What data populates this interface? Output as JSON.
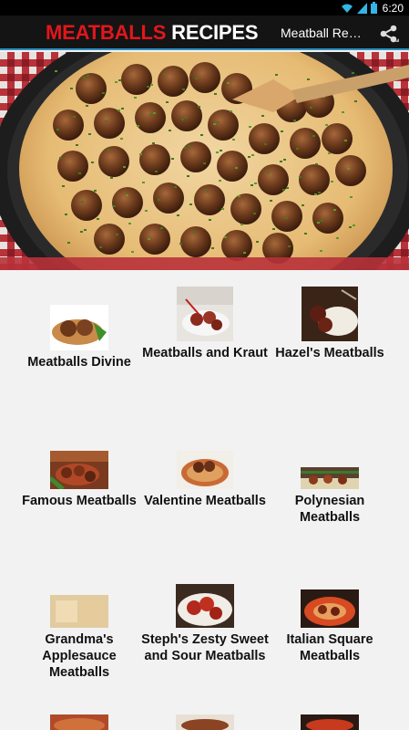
{
  "status_bar": {
    "time": "6:20",
    "icons": [
      "wifi-icon",
      "signal-icon",
      "battery-icon"
    ]
  },
  "header": {
    "title_part1": "MEATBALLS",
    "title_part2": "RECIPES",
    "subtitle": "Meatball Recipes",
    "share_icon": "share-icon",
    "colors": {
      "title_red": "#e3161b",
      "bar": "#141414",
      "accent": "#2d8fbe"
    }
  },
  "hero": {
    "alt": "Meatballs in creamy sauce with parsley in a skillet"
  },
  "recipes": [
    {
      "label": "Meatballs Divine"
    },
    {
      "label": "Meatballs and Kraut"
    },
    {
      "label": "Hazel's Meatballs"
    },
    {
      "label": "Famous Meatballs"
    },
    {
      "label": "Valentine Meatballs"
    },
    {
      "label": "Polynesian Meatballs"
    },
    {
      "label": "Grandma's Applesauce Meatballs"
    },
    {
      "label": "Steph's Zesty Sweet and Sour Meatballs"
    },
    {
      "label": "Italian Square Meatballs"
    },
    {
      "label": ""
    },
    {
      "label": ""
    },
    {
      "label": ""
    }
  ]
}
